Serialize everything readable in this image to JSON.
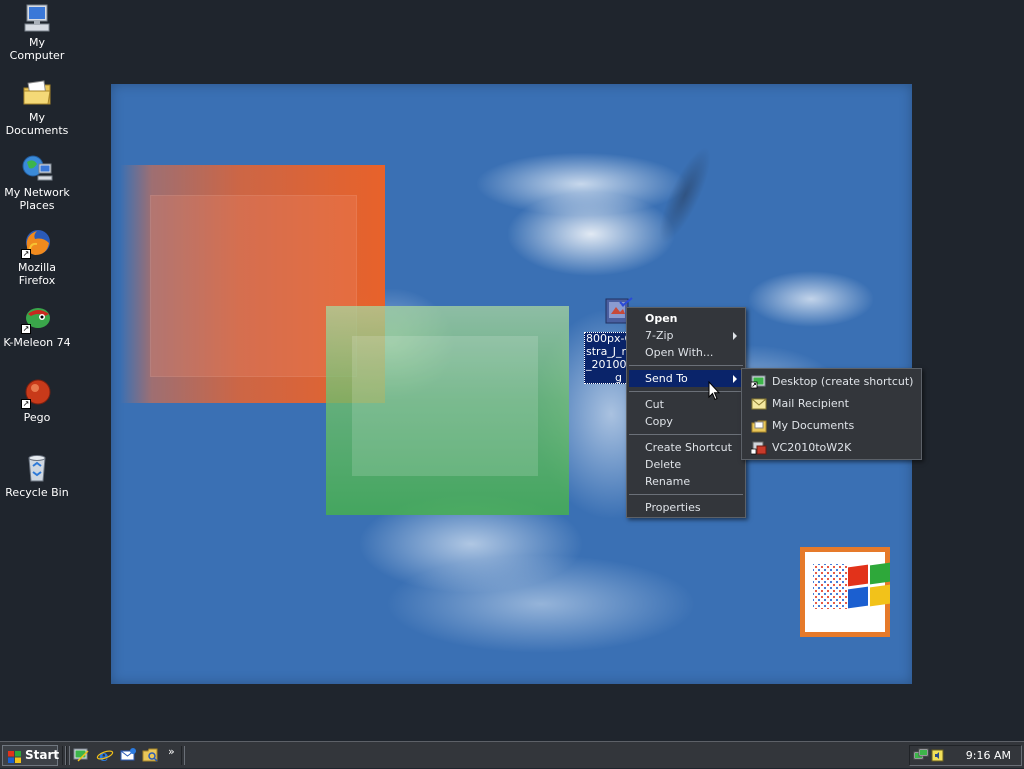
{
  "desktop_icons": [
    {
      "label": "My Computer",
      "icon": "my-computer-icon"
    },
    {
      "label": "My Documents",
      "icon": "my-documents-icon"
    },
    {
      "label": "My Network Places",
      "icon": "network-places-icon"
    },
    {
      "label": "Mozilla Firefox",
      "icon": "firefox-icon"
    },
    {
      "label": "K-Meleon 74",
      "icon": "k-meleon-icon"
    },
    {
      "label": "Pego",
      "icon": "pego-icon"
    },
    {
      "label": "Recycle Bin",
      "icon": "recycle-bin-icon"
    }
  ],
  "selected_file": {
    "label_lines": [
      "800px-C",
      "stra_J_n",
      "_20100",
      "g"
    ],
    "icon": "image-file-icon"
  },
  "context_menu": {
    "items": {
      "open": "Open",
      "seven_zip": "7-Zip",
      "open_with": "Open With...",
      "send_to": "Send To",
      "cut": "Cut",
      "copy": "Copy",
      "create_shortcut": "Create Shortcut",
      "delete": "Delete",
      "rename": "Rename",
      "properties": "Properties"
    }
  },
  "send_to_menu": {
    "items": {
      "desktop": "Desktop (create shortcut)",
      "mail": "Mail Recipient",
      "my_documents": "My Documents",
      "vc2010": "VC2010toW2K"
    }
  },
  "taskbar": {
    "start_label": "Start",
    "quick_launch_more": "»",
    "clock": "9:16 AM"
  },
  "colors": {
    "desktop_bg": "#1f252d",
    "wallpaper_blue": "#3a70b4",
    "menu_bg": "#33363b",
    "highlight": "#0a246a"
  }
}
